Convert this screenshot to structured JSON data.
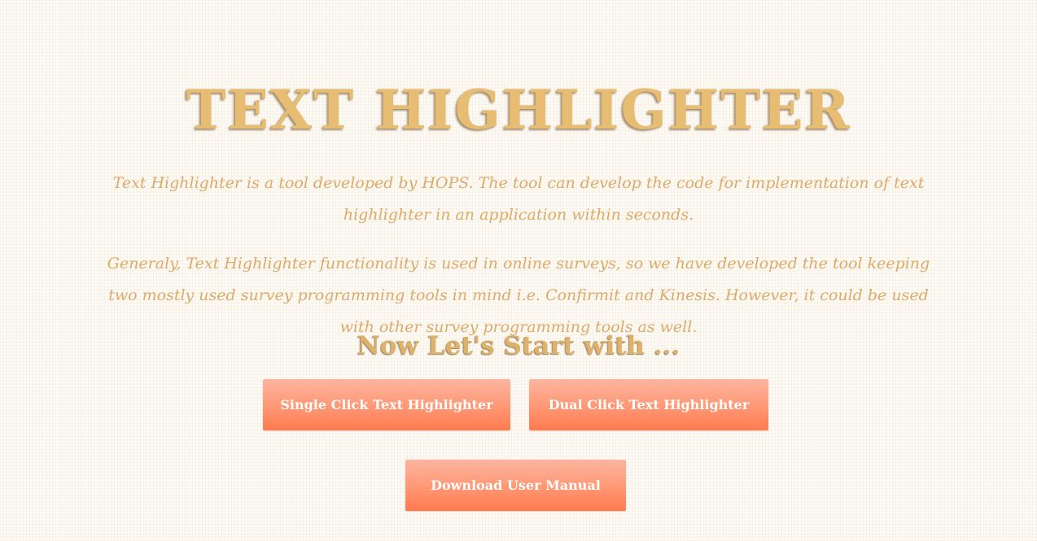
{
  "header": {
    "title": "TEXT HIGHLIGHTER"
  },
  "intro": {
    "paragraph_1": "Text Highlighter is a tool developed by HOPS. The tool can develop the code for implementation of text highlighter in an application within seconds.",
    "paragraph_2": "Generaly, Text Highlighter functionality is used in online surveys, so we have developed the tool keeping two mostly used survey programming tools in mind i.e. Confirmit and Kinesis. However, it could be used with other survey programming tools as well."
  },
  "start": {
    "heading": "Now Let's Start with ..."
  },
  "buttons": {
    "single_click": "Single Click Text Highlighter",
    "dual_click": "Dual Click Text Highlighter",
    "download_manual": "Download User Manual"
  },
  "colors": {
    "background": "#fdf9f3",
    "title": "#e6bd72",
    "paragraph": "#dcab6a",
    "button_top": "#fcb5a0",
    "button_bottom": "#ff7a4f",
    "button_text": "#ffffff"
  }
}
